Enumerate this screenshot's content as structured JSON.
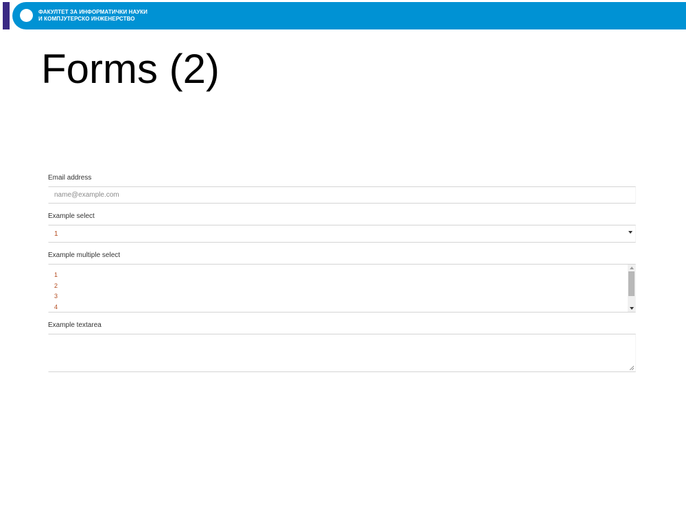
{
  "header": {
    "faculty_line1": "ФАКУЛТЕТ ЗА ИНФОРМАТИЧКИ НАУКИ",
    "faculty_line2": "И КОМПЈУТЕРСКО ИНЖЕНЕРСТВО",
    "brand_color": "#0092d4",
    "accent_color": "#3a2a84"
  },
  "slide": {
    "title": "Forms (2)"
  },
  "form": {
    "email": {
      "label": "Email address",
      "placeholder": "name@example.com"
    },
    "select": {
      "label": "Example select",
      "selected_value": "1"
    },
    "multi_select": {
      "label": "Example multiple select",
      "options": [
        "1",
        "2",
        "3",
        "4"
      ]
    },
    "textarea": {
      "label": "Example textarea",
      "value": ""
    }
  }
}
